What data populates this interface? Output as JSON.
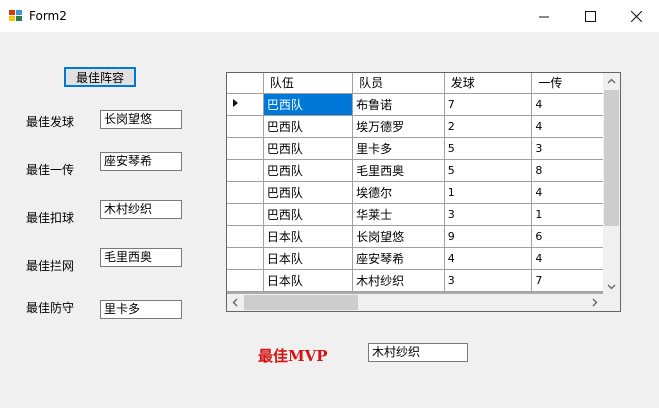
{
  "window": {
    "title": "Form2",
    "minimize_icon": "minimize-icon",
    "maximize_icon": "maximize-icon",
    "close_icon": "close-icon"
  },
  "button": {
    "best_lineup": "最佳阵容"
  },
  "fields": [
    {
      "label": "最佳发球",
      "value": "长岗望悠"
    },
    {
      "label": "最佳一传",
      "value": "座安琴希"
    },
    {
      "label": "最佳扣球",
      "value": "木村纱织"
    },
    {
      "label": "最佳拦网",
      "value": "毛里西奥"
    },
    {
      "label": "最佳防守",
      "value": "里卡多"
    }
  ],
  "mvp": {
    "label": "最佳MVP",
    "value": "木村纱织"
  },
  "grid": {
    "columns": [
      "队伍",
      "队员",
      "发球",
      "一传"
    ],
    "rows": [
      [
        "巴西队",
        "布鲁诺",
        "7",
        "4"
      ],
      [
        "巴西队",
        "埃万德罗",
        "2",
        "4"
      ],
      [
        "巴西队",
        "里卡多",
        "5",
        "3"
      ],
      [
        "巴西队",
        "毛里西奥",
        "5",
        "8"
      ],
      [
        "巴西队",
        "埃德尔",
        "1",
        "4"
      ],
      [
        "巴西队",
        "华莱士",
        "3",
        "1"
      ],
      [
        "日本队",
        "长岗望悠",
        "9",
        "6"
      ],
      [
        "日本队",
        "座安琴希",
        "4",
        "4"
      ],
      [
        "日本队",
        "木村纱织",
        "3",
        "7"
      ]
    ]
  },
  "colors": {
    "mvp": "#d41313",
    "selection": "#0078d7",
    "button_border": "#0078d7"
  }
}
